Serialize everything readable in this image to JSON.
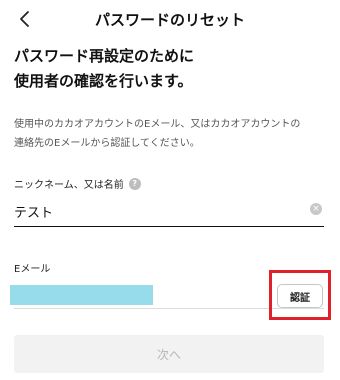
{
  "header": {
    "title": "パスワードのリセット",
    "back_icon": "chevron-left-icon"
  },
  "heading": {
    "line1": "パスワード再設定のために",
    "line2": "使用者の確認を行います。"
  },
  "description": {
    "line1": "使用中のカカオアカウントのEメール、又はカカオアカウントの",
    "line2": "連絡先のEメールから認証してください。"
  },
  "nickname": {
    "label": "ニックネーム、又は名前",
    "help_icon": "question-circle-icon",
    "help_glyph": "?",
    "value": "テスト",
    "clear_icon": "clear-circle-icon",
    "clear_glyph": "×"
  },
  "email": {
    "label": "Eメール",
    "verify_label": "認証"
  },
  "next_button": {
    "label": "次へ"
  },
  "colors": {
    "redaction": "#96dcea",
    "highlight": "#e0202a",
    "disabled_bg": "#f2f2f2",
    "disabled_text": "#b6b6b6"
  }
}
